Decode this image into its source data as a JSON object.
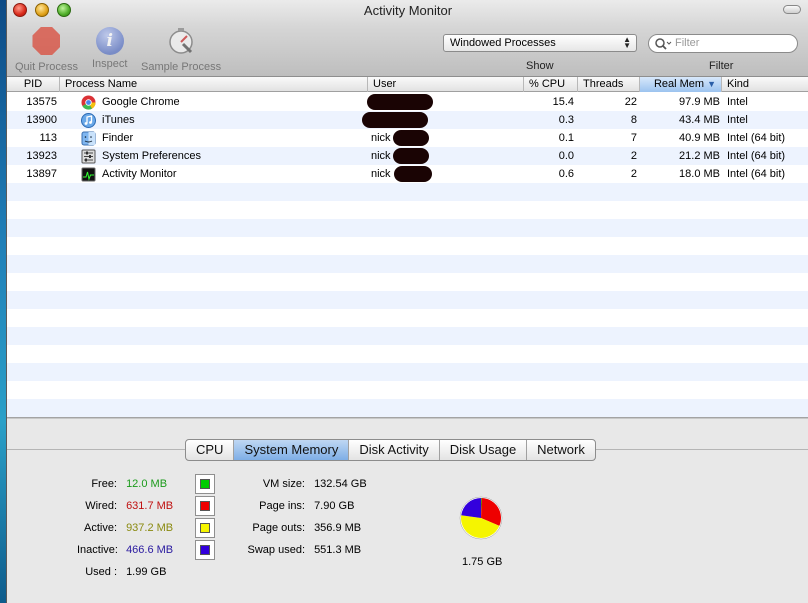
{
  "window": {
    "title": "Activity Monitor"
  },
  "toolbar": {
    "quit_label": "Quit Process",
    "inspect_label": "Inspect",
    "sample_label": "Sample Process",
    "show_label": "Show",
    "filter_label": "Filter",
    "show_select_value": "Windowed Processes",
    "filter_placeholder": "Filter"
  },
  "table": {
    "columns": [
      "PID",
      "Process Name",
      "User",
      "% CPU",
      "Threads",
      "Real Mem",
      "Kind"
    ],
    "sort_column": "Real Mem",
    "sort_direction": "descending",
    "rows": [
      {
        "pid": "13575",
        "icon": "chrome-icon",
        "name": "Google Chrome",
        "user": "",
        "cpu": "15.4",
        "threads": "22",
        "mem": "97.9 MB",
        "kind": "Intel"
      },
      {
        "pid": "13900",
        "icon": "itunes-icon",
        "name": "iTunes",
        "user": "",
        "cpu": "0.3",
        "threads": "8",
        "mem": "43.4 MB",
        "kind": "Intel"
      },
      {
        "pid": "113",
        "icon": "finder-icon",
        "name": "Finder",
        "user": "nick",
        "cpu": "0.1",
        "threads": "7",
        "mem": "40.9 MB",
        "kind": "Intel (64 bit)"
      },
      {
        "pid": "13923",
        "icon": "system-preferences-icon",
        "name": "System Preferences",
        "user": "nick",
        "cpu": "0.0",
        "threads": "2",
        "mem": "21.2 MB",
        "kind": "Intel (64 bit)"
      },
      {
        "pid": "13897",
        "icon": "activity-monitor-icon",
        "name": "Activity Monitor",
        "user": "nick",
        "cpu": "0.6",
        "threads": "2",
        "mem": "18.0 MB",
        "kind": "Intel (64 bit)"
      }
    ]
  },
  "tabs": [
    "CPU",
    "System Memory",
    "Disk Activity",
    "Disk Usage",
    "Network"
  ],
  "active_tab": "System Memory",
  "memory": {
    "free": {
      "label": "Free:",
      "value": "12.0 MB",
      "color": "#00cc00",
      "text_color": "#1a9a1a"
    },
    "wired": {
      "label": "Wired:",
      "value": "631.7 MB",
      "color": "#ee0000",
      "text_color": "#c01010"
    },
    "active": {
      "label": "Active:",
      "value": "937.2 MB",
      "color": "#f5f500",
      "text_color": "#8a8a10"
    },
    "inactive": {
      "label": "Inactive:",
      "value": "466.6 MB",
      "color": "#3300dd",
      "text_color": "#2a1aa0"
    },
    "used": {
      "label": "Used :",
      "value": "1.99 GB"
    },
    "vm_size": {
      "label": "VM size:",
      "value": "132.54 GB"
    },
    "page_ins": {
      "label": "Page ins:",
      "value": "7.90 GB"
    },
    "page_outs": {
      "label": "Page outs:",
      "value": "356.9 MB"
    },
    "swap_used": {
      "label": "Swap used:",
      "value": "551.3 MB"
    },
    "total": "1.75 GB"
  }
}
